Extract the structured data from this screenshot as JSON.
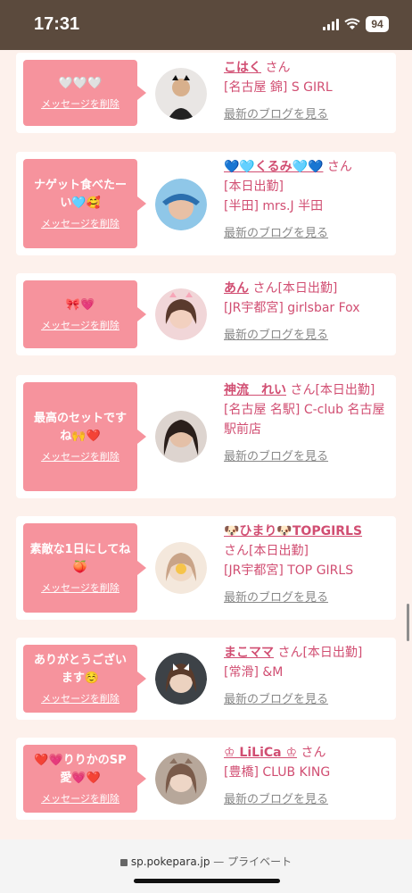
{
  "status_bar": {
    "time": "17:31",
    "battery": "94"
  },
  "messages": [
    {
      "bubble": "🤍🤍🤍",
      "delete": "メッセージを削除",
      "name": "こはく",
      "san": "さん",
      "badge": "",
      "area": "[名古屋 錦] S GIRL",
      "blog": "最新のブログを見る"
    },
    {
      "bubble": "ナゲット食べたーい🩵🥰",
      "delete": "メッセージを削除",
      "name": "💙🩵くるみ🩵💙",
      "san": "さん",
      "badge": "[本日出勤]",
      "area": "[半田] mrs.J 半田",
      "blog": "最新のブログを見る"
    },
    {
      "bubble": "🎀💗",
      "delete": "メッセージを削除",
      "name": "あん",
      "san": "さん",
      "badge": "[本日出勤]",
      "area": "[JR宇都宮] girlsbar Fox",
      "blog": "最新のブログを見る"
    },
    {
      "bubble": "最高のセットですね🙌❤️",
      "delete": "メッセージを削除",
      "name": "神流　れい",
      "san": "さん",
      "badge": "[本日出勤]",
      "area": "[名古屋 名駅] C-club 名古屋駅前店",
      "blog": "最新のブログを見る"
    },
    {
      "bubble": "素敵な1日にしてね🍑",
      "delete": "メッセージを削除",
      "name": "🐶ひまり🐶TOPGIRLS",
      "san": "さん",
      "badge": "[本日出勤]",
      "area": "[JR宇都宮] TOP GIRLS",
      "blog": "最新のブログを見る"
    },
    {
      "bubble": "ありがとうございます☺️",
      "delete": "メッセージを削除",
      "name": "まこママ",
      "san": "さん",
      "badge": "[本日出勤]",
      "area": "[常滑] &M",
      "blog": "最新のブログを見る"
    },
    {
      "bubble": "❤️💗りりかのSP愛💗❤️",
      "delete": "メッセージを削除",
      "name": "♔ LiLiCa ♔",
      "san": "さん",
      "badge": "",
      "area": "[豊橋] CLUB KING",
      "blog": "最新のブログを見る"
    }
  ],
  "browser_bar": {
    "domain": "sp.pokepara.jp",
    "separator": "—",
    "mode": "プライベート"
  },
  "colors": {
    "accent": "#d14e72",
    "bubble": "#f6939d",
    "background": "#fdf1ec",
    "status_bar": "#5b4a3d"
  },
  "icons": {
    "signal": "signal-icon",
    "wifi": "wifi-icon",
    "battery": "battery-icon",
    "lock": "lock-icon"
  }
}
